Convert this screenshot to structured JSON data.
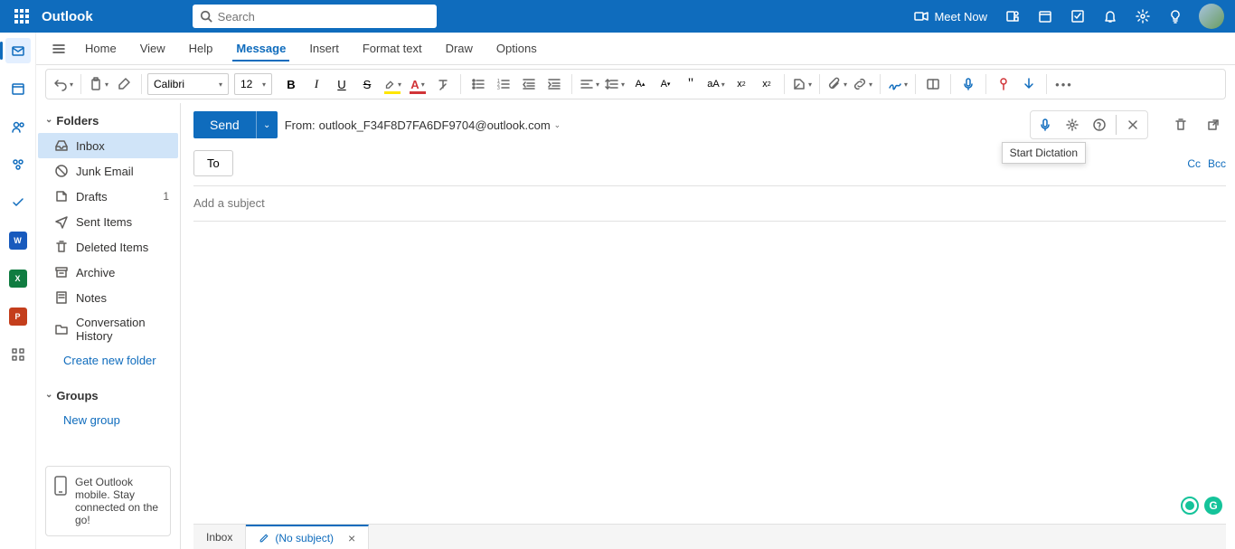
{
  "header": {
    "brand": "Outlook",
    "search_placeholder": "Search",
    "meet_now": "Meet Now"
  },
  "tabs": [
    "Home",
    "View",
    "Help",
    "Message",
    "Insert",
    "Format text",
    "Draw",
    "Options"
  ],
  "active_tab": "Message",
  "ribbon": {
    "font_name": "Calibri",
    "font_size": "12"
  },
  "folders_header": "Folders",
  "folders": [
    {
      "icon": "inbox",
      "label": "Inbox",
      "active": true
    },
    {
      "icon": "junk",
      "label": "Junk Email"
    },
    {
      "icon": "drafts",
      "label": "Drafts",
      "count": "1"
    },
    {
      "icon": "sent",
      "label": "Sent Items"
    },
    {
      "icon": "trash",
      "label": "Deleted Items"
    },
    {
      "icon": "archive",
      "label": "Archive"
    },
    {
      "icon": "notes",
      "label": "Notes"
    },
    {
      "icon": "history",
      "label": "Conversation History"
    }
  ],
  "create_folder": "Create new folder",
  "groups_header": "Groups",
  "new_group": "New group",
  "mobile_ad": "Get Outlook mobile. Stay connected on the go!",
  "compose": {
    "send": "Send",
    "from_label": "From:",
    "from_addr": "outlook_F34F8D7FA6DF9704@outlook.com",
    "to_label": "To",
    "cc": "Cc",
    "bcc": "Bcc",
    "subject_placeholder": "Add a subject",
    "tooltip": "Start Dictation"
  },
  "bottom": {
    "inbox_tab": "Inbox",
    "draft_tab": "(No subject)"
  }
}
